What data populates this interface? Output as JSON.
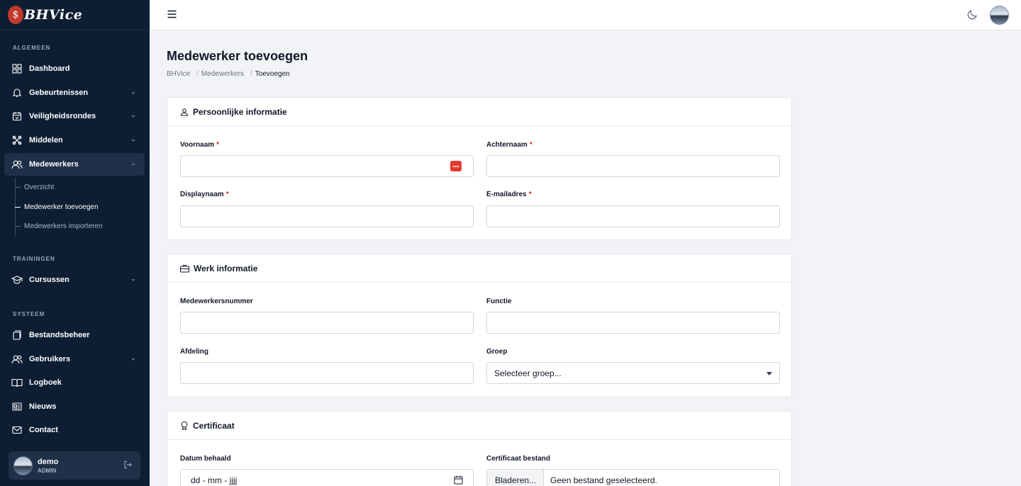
{
  "brand": {
    "mark": "$",
    "name": "BHVice"
  },
  "sidebar": {
    "sections": {
      "general": "ALGEMEEN",
      "trainings": "TRAININGEN",
      "system": "SYSTEEM"
    },
    "items": [
      {
        "label": "Dashboard",
        "icon": "grid-icon"
      },
      {
        "label": "Gebeurtenissen",
        "icon": "bell-icon"
      },
      {
        "label": "Veiligheidsrondes",
        "icon": "calendar-check-icon"
      },
      {
        "label": "Middelen",
        "icon": "tools-icon"
      },
      {
        "label": "Medewerkers",
        "icon": "users-icon"
      },
      {
        "label": "Cursussen",
        "icon": "graduation-icon"
      },
      {
        "label": "Bestandsbeheer",
        "icon": "files-icon"
      },
      {
        "label": "Gebruikers",
        "icon": "users-icon"
      },
      {
        "label": "Logboek",
        "icon": "book-icon"
      },
      {
        "label": "Nieuws",
        "icon": "news-icon"
      },
      {
        "label": "Contact",
        "icon": "mail-icon"
      }
    ],
    "subitems": [
      {
        "label": "Overzicht"
      },
      {
        "label": "Medewerker toevoegen"
      },
      {
        "label": "Medewerkers importeren"
      }
    ],
    "user": {
      "name": "demo",
      "role": "ADMIN"
    }
  },
  "page": {
    "title": "Medewerker toevoegen",
    "breadcrumb": [
      "BHVice",
      "Medewerkers",
      "Toevoegen"
    ],
    "separator": "/"
  },
  "cards": {
    "personal": {
      "title": "Persoonlijke informatie",
      "first_name": {
        "label": "Voornaam",
        "value": ""
      },
      "last_name": {
        "label": "Achternaam",
        "value": ""
      },
      "display_name": {
        "label": "Displaynaam",
        "value": ""
      },
      "email": {
        "label": "E-mailadres",
        "value": ""
      },
      "required_mark": "*"
    },
    "work": {
      "title": "Werk informatie",
      "employee_number": {
        "label": "Medewerkersnummer",
        "value": ""
      },
      "function": {
        "label": "Functie",
        "value": ""
      },
      "department": {
        "label": "Afdeling",
        "value": ""
      },
      "group": {
        "label": "Groep",
        "selected": "Selecteer groep..."
      }
    },
    "certificate": {
      "title": "Certificaat",
      "date": {
        "label": "Datum behaald",
        "placeholder": "dd - mm - jjjj"
      },
      "file": {
        "label": "Certificaat bestand",
        "button": "Bladeren...",
        "status": "Geen bestand geselecteerd."
      }
    }
  },
  "colors": {
    "sidebar": "#0d1e33",
    "accent_red": "#dc2626",
    "background": "#f1f3f6"
  }
}
